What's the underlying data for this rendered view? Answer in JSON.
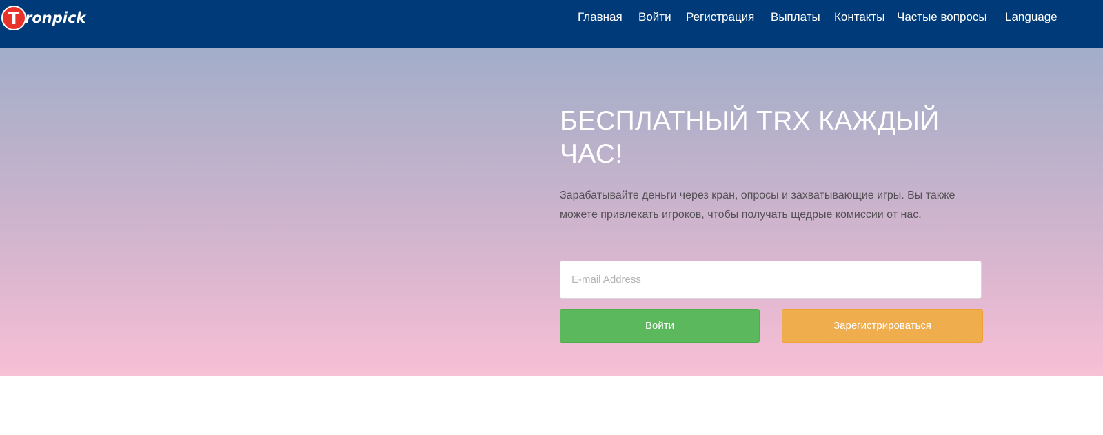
{
  "brand": {
    "logo_letter": "T",
    "logo_text": "ronpick"
  },
  "nav": {
    "items": [
      {
        "label": "Главная"
      },
      {
        "label": "Войти"
      },
      {
        "label": "Регистрация"
      },
      {
        "label": "Выплаты"
      },
      {
        "label": "Контакты"
      },
      {
        "label": "Частые вопросы"
      },
      {
        "label": "Language"
      }
    ]
  },
  "hero": {
    "title": "БЕСПЛАТНЫЙ TRX КАЖДЫЙ ЧАС!",
    "description": "Зарабатывайте деньги через кран, опросы и захватывающие игры. Вы также можете привлекать игроков, чтобы получать щедрые комиссии от нас.",
    "email_placeholder": "E-mail Address",
    "email_value": "",
    "login_button": "Войти",
    "register_button": "Зарегистрироваться"
  },
  "colors": {
    "navbar": "#003a78",
    "login_button": "#5cb85c",
    "register_button": "#f0ad4e",
    "logo_badge": "#e8322a"
  },
  "icons": {
    "logo": "tronpick-logo-icon"
  }
}
